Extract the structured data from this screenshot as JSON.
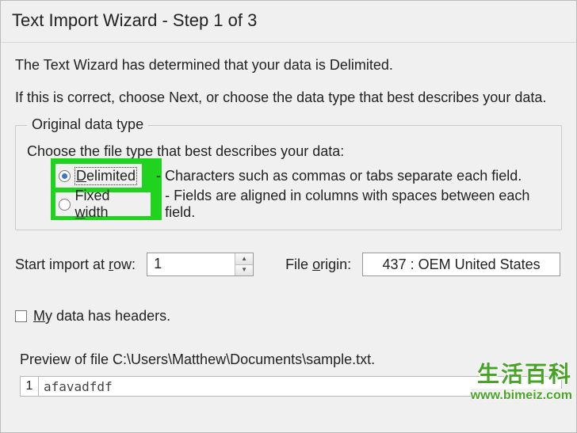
{
  "title": "Text Import Wizard - Step 1 of 3",
  "intro": {
    "line1": "The Text Wizard has determined that your data is Delimited.",
    "line2": "If this is correct, choose Next, or choose the data type that best describes your data."
  },
  "original": {
    "legend": "Original data type",
    "instr": "Choose the file type that best describes your data:",
    "options": [
      {
        "label_pre": "",
        "accel": "D",
        "label_post": "elimited",
        "selected": true,
        "desc": "- Characters such as commas or tabs separate each field."
      },
      {
        "label_pre": "Fixed ",
        "accel": "w",
        "label_post": "idth",
        "selected": false,
        "desc": "- Fields are aligned in columns with spaces between each field."
      }
    ]
  },
  "start_row": {
    "label_pre": "Start import at ",
    "accel": "r",
    "label_post": "ow:",
    "value": "1"
  },
  "origin": {
    "label_pre": "File ",
    "accel": "o",
    "label_post": "rigin:",
    "value": "437 : OEM United States"
  },
  "headers": {
    "accel": "M",
    "label_post": "y data has headers.",
    "checked": false
  },
  "preview": {
    "label": "Preview of file C:\\Users\\Matthew\\Documents\\sample.txt.",
    "line_no": "1",
    "line_text": "afavadfdf"
  },
  "watermark": {
    "cn": "生活百科",
    "url": "www.bimeiz.com"
  }
}
